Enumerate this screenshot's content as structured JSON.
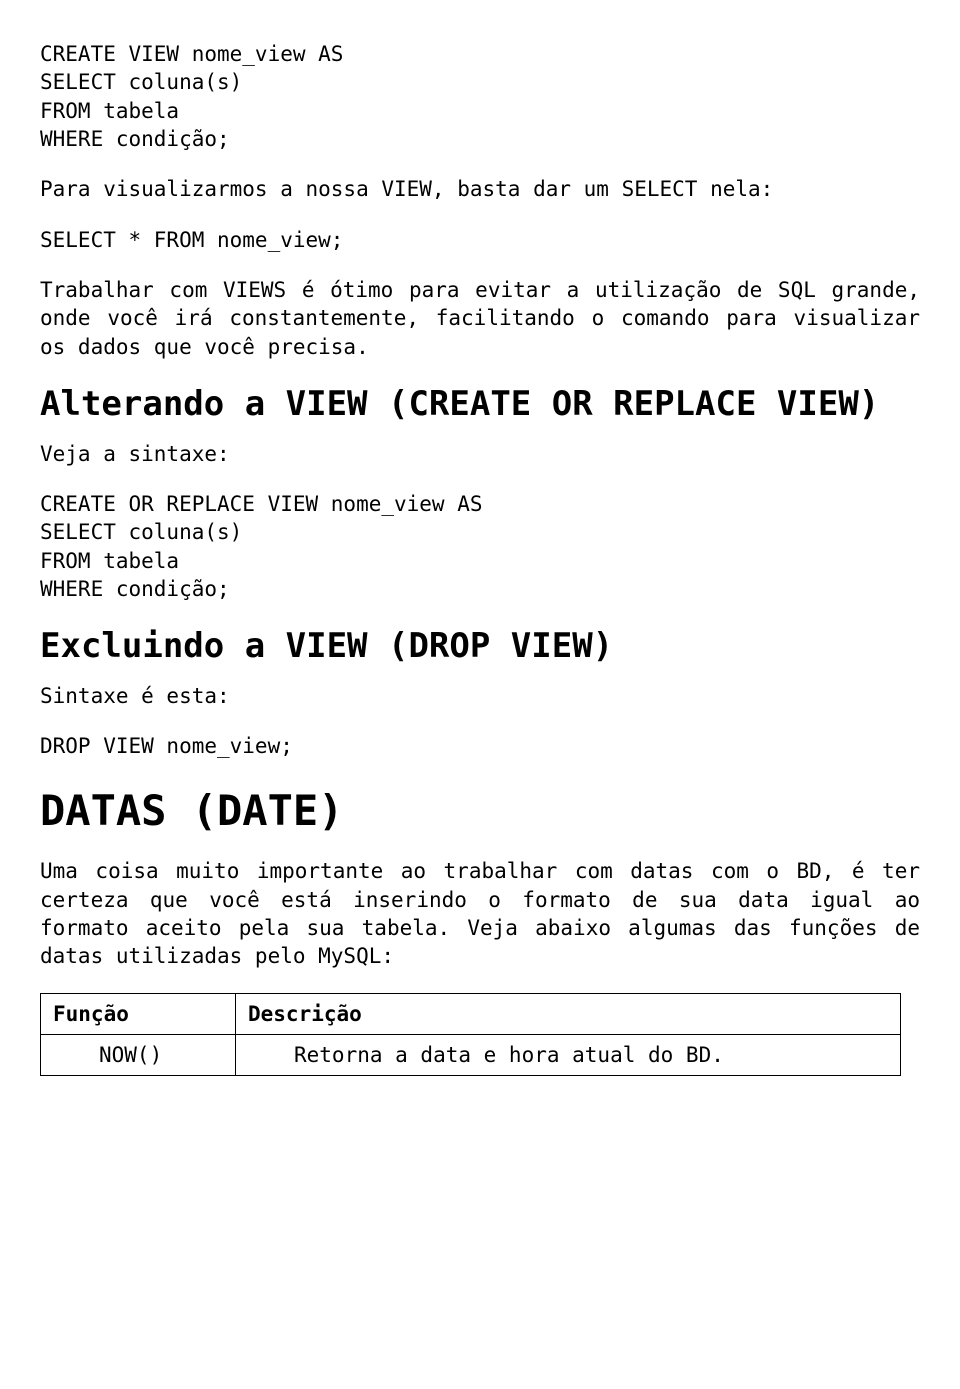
{
  "code1": "CREATE VIEW nome_view AS\nSELECT coluna(s)\nFROM tabela\nWHERE condição;",
  "para1": "Para visualizarmos a nossa VIEW, basta dar um SELECT nela:",
  "code2": "SELECT * FROM nome_view;",
  "para2": "Trabalhar com VIEWS é ótimo para evitar a utilização de SQL grande, onde você irá constantemente, facilitando o comando para visualizar os dados que você precisa.",
  "h2_1": "Alterando a VIEW (CREATE OR REPLACE VIEW)",
  "para3": "Veja a sintaxe:",
  "code3": "CREATE OR REPLACE VIEW nome_view AS\nSELECT coluna(s)\nFROM tabela\nWHERE condição;",
  "h2_2": "Excluindo a VIEW (DROP VIEW)",
  "para4": "Sintaxe é esta:",
  "code4": "DROP VIEW nome_view;",
  "h1": "DATAS (DATE)",
  "para5": "Uma coisa muito importante ao trabalhar com datas com o BD, é ter certeza que você está inserindo o formato de sua data igual ao formato aceito pela sua tabela. Veja abaixo algumas das funções de datas utilizadas pelo MySQL:",
  "table": {
    "headers": [
      "Função",
      "Descrição"
    ],
    "rows": [
      [
        "NOW()",
        "Retorna a data e hora atual do BD."
      ]
    ]
  }
}
